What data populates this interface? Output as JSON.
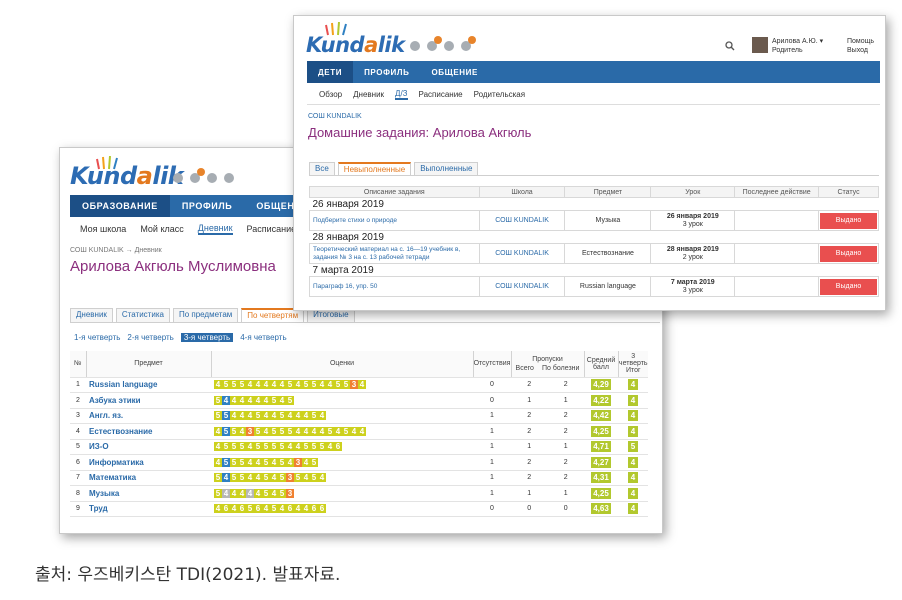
{
  "back": {
    "logo": "Kundalik",
    "nav": [
      "Образование",
      "Профиль",
      "Общение"
    ],
    "subnav": [
      "Моя школа",
      "Мой класс",
      "Дневник",
      "Расписание"
    ],
    "breadcrumb": "СОШ KUNDALIK → Дневник",
    "title": "Арилова Акгюль Муслимовна",
    "tabs": [
      "Дневник",
      "Статистика",
      "По предметам",
      "По четвертям",
      "Итоговые"
    ],
    "quarters": [
      "1-я четверть",
      "2-я четверть",
      "3-я четверть",
      "4-я четверть"
    ],
    "columns": {
      "num": "№",
      "subject": "Предмет",
      "marks": "Оценки",
      "absent": "Отсутствия",
      "absences": "Пропуски",
      "total": "Всего",
      "ill": "По болезни",
      "avg": "Средний балл",
      "final": "3 четверть Итог"
    },
    "rows": [
      {
        "n": "1",
        "subject": "Russian language",
        "marks": "4 5 5 5 4 4 4 4 4 5 4 5 5 4 4 5 5 3 4",
        "absent": "0",
        "total": "2",
        "ill": "2",
        "avg": "4,29",
        "final": "4"
      },
      {
        "n": "2",
        "subject": "Азбука этики",
        "marks": "5 4 4 4 4 4 4 5 4 5",
        "absent": "0",
        "total": "1",
        "ill": "1",
        "avg": "4,22",
        "final": "4"
      },
      {
        "n": "3",
        "subject": "Англ. яз.",
        "marks": "5 5 4 4 4 5 4 4 5 4 4 4 5 4",
        "absent": "1",
        "total": "2",
        "ill": "2",
        "avg": "4,42",
        "final": "4"
      },
      {
        "n": "4",
        "subject": "Естествознание",
        "marks": "4 5 5 4 3 5 4 5 5 5 4 4 4 4 5 4 5 4 4",
        "absent": "1",
        "total": "2",
        "ill": "2",
        "avg": "4,25",
        "final": "4"
      },
      {
        "n": "5",
        "subject": "ИЗ-О",
        "marks": "4 5 5 5 4 5 5 5 5 4 4 5 5 5 4 6",
        "absent": "1",
        "total": "1",
        "ill": "1",
        "avg": "4,71",
        "final": "5"
      },
      {
        "n": "6",
        "subject": "Информатика",
        "marks": "4 5 5 5 4 4 5 4 5 4 3 4 5",
        "absent": "1",
        "total": "2",
        "ill": "2",
        "avg": "4,27",
        "final": "4"
      },
      {
        "n": "7",
        "subject": "Математика",
        "marks": "5 4 5 5 4 4 5 4 5 3 5 4 5 4",
        "absent": "1",
        "total": "2",
        "ill": "2",
        "avg": "4,31",
        "final": "4"
      },
      {
        "n": "8",
        "subject": "Музыка",
        "marks": "5 4 4 4 4 4 5 4 5 3",
        "absent": "1",
        "total": "1",
        "ill": "1",
        "avg": "4,25",
        "final": "4"
      },
      {
        "n": "9",
        "subject": "Труд",
        "marks": "4 6 4 6 5 6 4 5 4 6 4 4 6 6",
        "absent": "0",
        "total": "0",
        "ill": "0",
        "avg": "4,63",
        "final": "4"
      }
    ]
  },
  "front": {
    "logo": "Kundalik",
    "user": "Арилова А.Ю. ▾",
    "user_role": "Родитель",
    "help": "Помощь",
    "logout": "Выход",
    "nav": [
      "Дети",
      "Профиль",
      "Общение"
    ],
    "subnav": [
      "Обзор",
      "Дневник",
      "Д/З",
      "Расписание",
      "Родительская"
    ],
    "breadcrumb": "СОШ KUNDALIK",
    "title": "Домашние задания: Арилова Акгюль",
    "tabs": [
      "Все",
      "Невыполненные",
      "Выполненные"
    ],
    "columns": [
      "Описание задания",
      "Школа",
      "Предмет",
      "Урок",
      "Последнее действие",
      "Статус"
    ],
    "groups": [
      {
        "date": "26 января 2019",
        "items": [
          {
            "desc": "Подберите стихи о природе",
            "school": "СОШ KUNDALIK",
            "subject": "Музыка",
            "lesson_date": "26 января 2019",
            "lesson_no": "3 урок",
            "status": "Выдано"
          }
        ]
      },
      {
        "date": "28 января 2019",
        "items": [
          {
            "desc": "Теоретический материал на с. 16—19 учебник в, задания № 3 на с. 13 рабочей тетради",
            "school": "СОШ KUNDALIK",
            "subject": "Естествознание",
            "lesson_date": "28 января 2019",
            "lesson_no": "2 урок",
            "status": "Выдано"
          }
        ]
      },
      {
        "date": "7 марта 2019",
        "items": [
          {
            "desc": "Параграф 16, упр. 50",
            "school": "СОШ KUNDALIK",
            "subject": "Russian language",
            "lesson_date": "7 марта 2019",
            "lesson_no": "3 урок",
            "status": "Выдано"
          }
        ]
      }
    ]
  },
  "caption": "출처: 우즈베키스탄 TDI(2021). 발표자료."
}
